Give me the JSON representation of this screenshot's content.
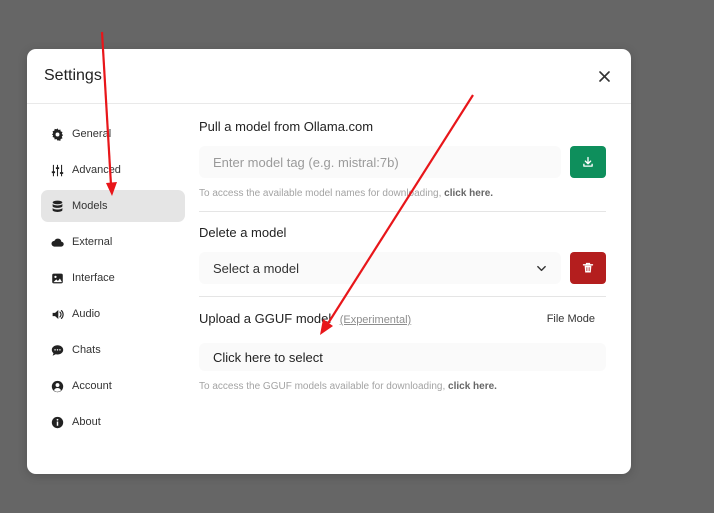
{
  "modal": {
    "title": "Settings"
  },
  "sidebar": {
    "items": [
      {
        "label": "General",
        "icon": "gear-icon"
      },
      {
        "label": "Advanced",
        "icon": "sliders-icon"
      },
      {
        "label": "Models",
        "icon": "database-icon"
      },
      {
        "label": "External",
        "icon": "cloud-icon"
      },
      {
        "label": "Interface",
        "icon": "image-icon"
      },
      {
        "label": "Audio",
        "icon": "speaker-icon"
      },
      {
        "label": "Chats",
        "icon": "chat-bubble-icon"
      },
      {
        "label": "Account",
        "icon": "user-circle-icon"
      },
      {
        "label": "About",
        "icon": "info-icon"
      }
    ],
    "active": "Models"
  },
  "pull": {
    "title": "Pull a model from Ollama.com",
    "placeholder": "Enter model tag (e.g. mistral:7b)",
    "hint": "To access the available model names for downloading,",
    "hint_link": "click here.",
    "button_icon": "download-icon"
  },
  "delete": {
    "title": "Delete a model",
    "select_value": "Select a model",
    "button_icon": "trash-icon"
  },
  "upload": {
    "title": "Upload a GGUF model",
    "experimental": "(Experimental)",
    "file_mode": "File Mode",
    "select_label": "Click here to select",
    "hint": "To access the GGUF models available for downloading,",
    "hint_link": "click here."
  },
  "colors": {
    "backdrop": "#666666",
    "pull_button": "#0e8f5c",
    "delete_button": "#b41e1e",
    "annotation_arrow": "#e8161a"
  }
}
